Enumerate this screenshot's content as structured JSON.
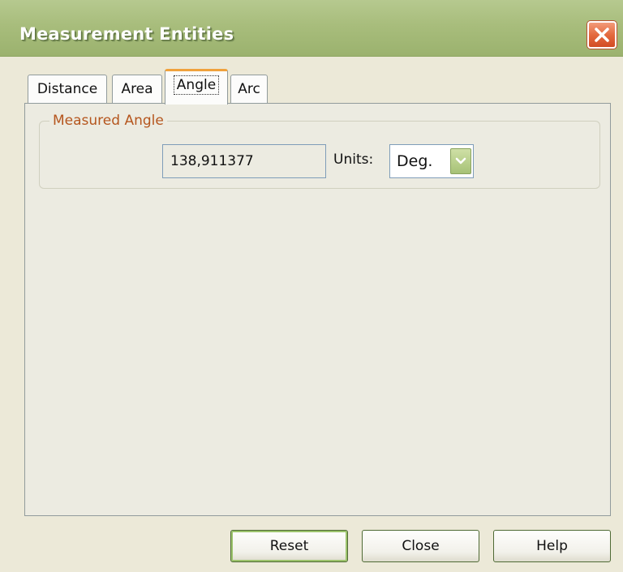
{
  "window": {
    "title": "Measurement Entities"
  },
  "tabs": [
    {
      "label": "Distance"
    },
    {
      "label": "Area"
    },
    {
      "label": "Angle"
    },
    {
      "label": "Arc"
    }
  ],
  "active_tab": "Angle",
  "group": {
    "label": "Measured Angle",
    "value": "138,911377",
    "units_label": "Units:",
    "units_selected": "Deg."
  },
  "buttons": {
    "reset": "Reset",
    "close": "Close",
    "help": "Help"
  },
  "icons": {
    "close": "close-icon",
    "dropdown": "chevron-down-icon"
  },
  "colors": {
    "titlebar": "#a8bd7c",
    "close_button": "#e46a3f",
    "active_tab_accent": "#f0a23c",
    "group_label": "#b5561e",
    "window_bg": "#ece9d8"
  }
}
